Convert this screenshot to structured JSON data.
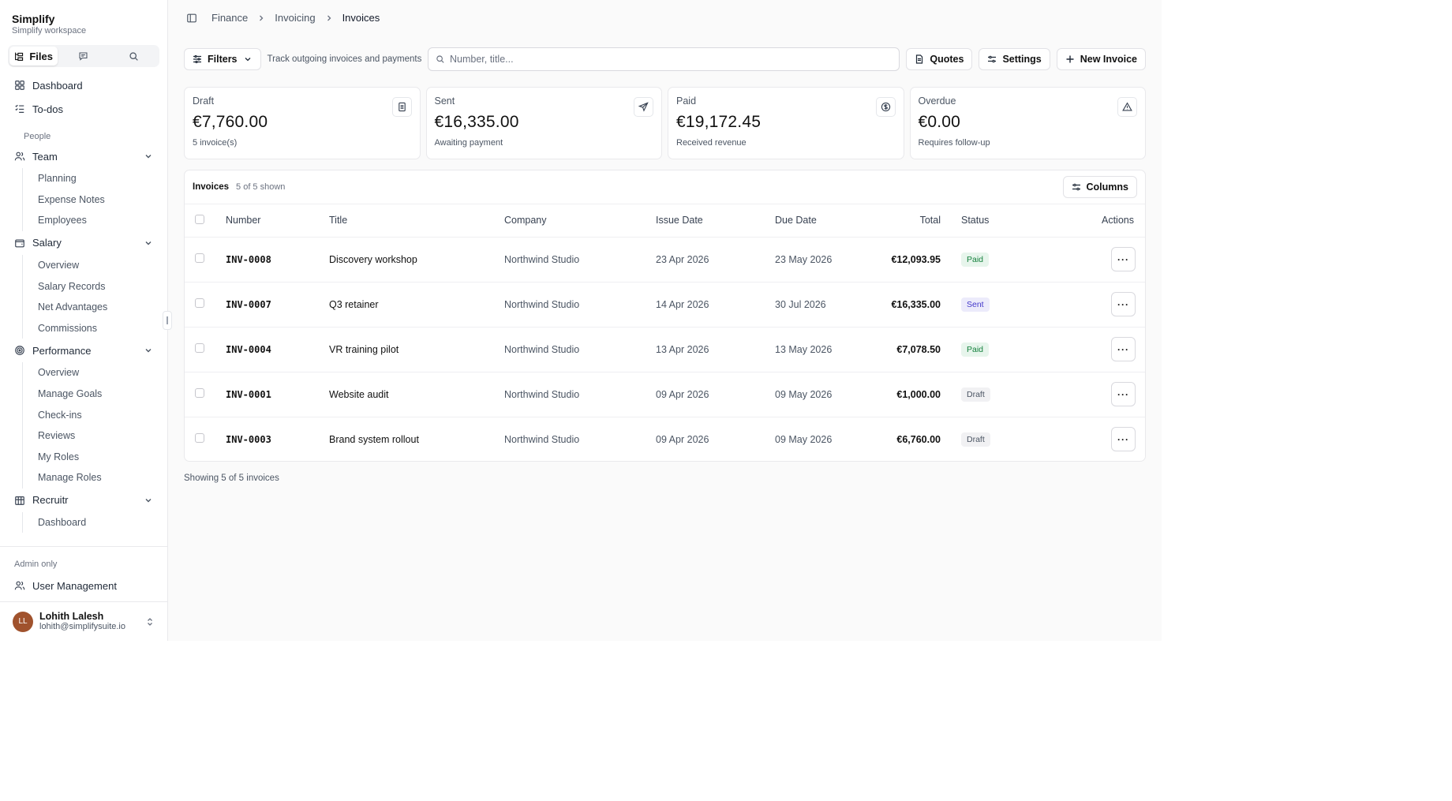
{
  "app": {
    "name": "Simplify",
    "workspace": "Simplify workspace"
  },
  "sidebar": {
    "tabs": [
      {
        "label": "Files",
        "icon": "files-icon"
      },
      {
        "label": "",
        "icon": "chat-icon"
      },
      {
        "label": "",
        "icon": "search-icon"
      }
    ],
    "top_items": [
      {
        "label": "Dashboard"
      },
      {
        "label": "To-dos"
      }
    ],
    "section_people": "People",
    "groups": {
      "team": {
        "label": "Team",
        "items": [
          "Planning",
          "Expense Notes",
          "Employees"
        ]
      },
      "salary": {
        "label": "Salary",
        "items": [
          "Overview",
          "Salary Records",
          "Net Advantages",
          "Commissions"
        ]
      },
      "performance": {
        "label": "Performance",
        "items": [
          "Overview",
          "Manage Goals",
          "Check-ins",
          "Reviews",
          "My Roles",
          "Manage Roles"
        ]
      },
      "recruitr": {
        "label": "Recruitr",
        "items": [
          "Dashboard"
        ]
      }
    },
    "admin_label": "Admin only",
    "admin_item": "User Management",
    "user": {
      "initials": "LL",
      "name": "Lohith Lalesh",
      "email": "lohith@simplifysuite.io"
    }
  },
  "breadcrumb": [
    "Finance",
    "Invoicing",
    "Invoices"
  ],
  "toolbar": {
    "filters_label": "Filters",
    "hint": "Track outgoing invoices and payments",
    "search_placeholder": "Number, title...",
    "quotes_label": "Quotes",
    "settings_label": "Settings",
    "new_label": "New Invoice"
  },
  "cards": [
    {
      "label": "Draft",
      "value": "€7,760.00",
      "sub": "5 invoice(s)",
      "icon": "document-icon"
    },
    {
      "label": "Sent",
      "value": "€16,335.00",
      "sub": "Awaiting payment",
      "icon": "send-icon"
    },
    {
      "label": "Paid",
      "value": "€19,172.45",
      "sub": "Received revenue",
      "icon": "dollar-circle-icon"
    },
    {
      "label": "Overdue",
      "value": "€0.00",
      "sub": "Requires follow-up",
      "icon": "alert-triangle-icon"
    }
  ],
  "table": {
    "title": "Invoices",
    "count": "5 of 5 shown",
    "columns_label": "Columns",
    "headers": [
      "Number",
      "Title",
      "Company",
      "Issue Date",
      "Due Date",
      "Total",
      "Status",
      "Actions"
    ],
    "rows": [
      {
        "number": "INV-0008",
        "title": "Discovery workshop",
        "company": "Northwind Studio",
        "issue": "23 Apr 2026",
        "due": "23 May 2026",
        "total": "€12,093.95",
        "status": "Paid"
      },
      {
        "number": "INV-0007",
        "title": "Q3 retainer",
        "company": "Northwind Studio",
        "issue": "14 Apr 2026",
        "due": "30 Jul 2026",
        "total": "€16,335.00",
        "status": "Sent"
      },
      {
        "number": "INV-0004",
        "title": "VR training pilot",
        "company": "Northwind Studio",
        "issue": "13 Apr 2026",
        "due": "13 May 2026",
        "total": "€7,078.50",
        "status": "Paid"
      },
      {
        "number": "INV-0001",
        "title": "Website audit",
        "company": "Northwind Studio",
        "issue": "09 Apr 2026",
        "due": "09 May 2026",
        "total": "€1,000.00",
        "status": "Draft"
      },
      {
        "number": "INV-0003",
        "title": "Brand system rollout",
        "company": "Northwind Studio",
        "issue": "09 Apr 2026",
        "due": "09 May 2026",
        "total": "€6,760.00",
        "status": "Draft"
      }
    ],
    "action_glyph": "···"
  },
  "footer_note": "Showing 5 of 5 invoices",
  "colors": {
    "paid": "#15803d",
    "sent": "#4338ca",
    "draft": "#4b5563",
    "avatar": "#a0522d"
  }
}
